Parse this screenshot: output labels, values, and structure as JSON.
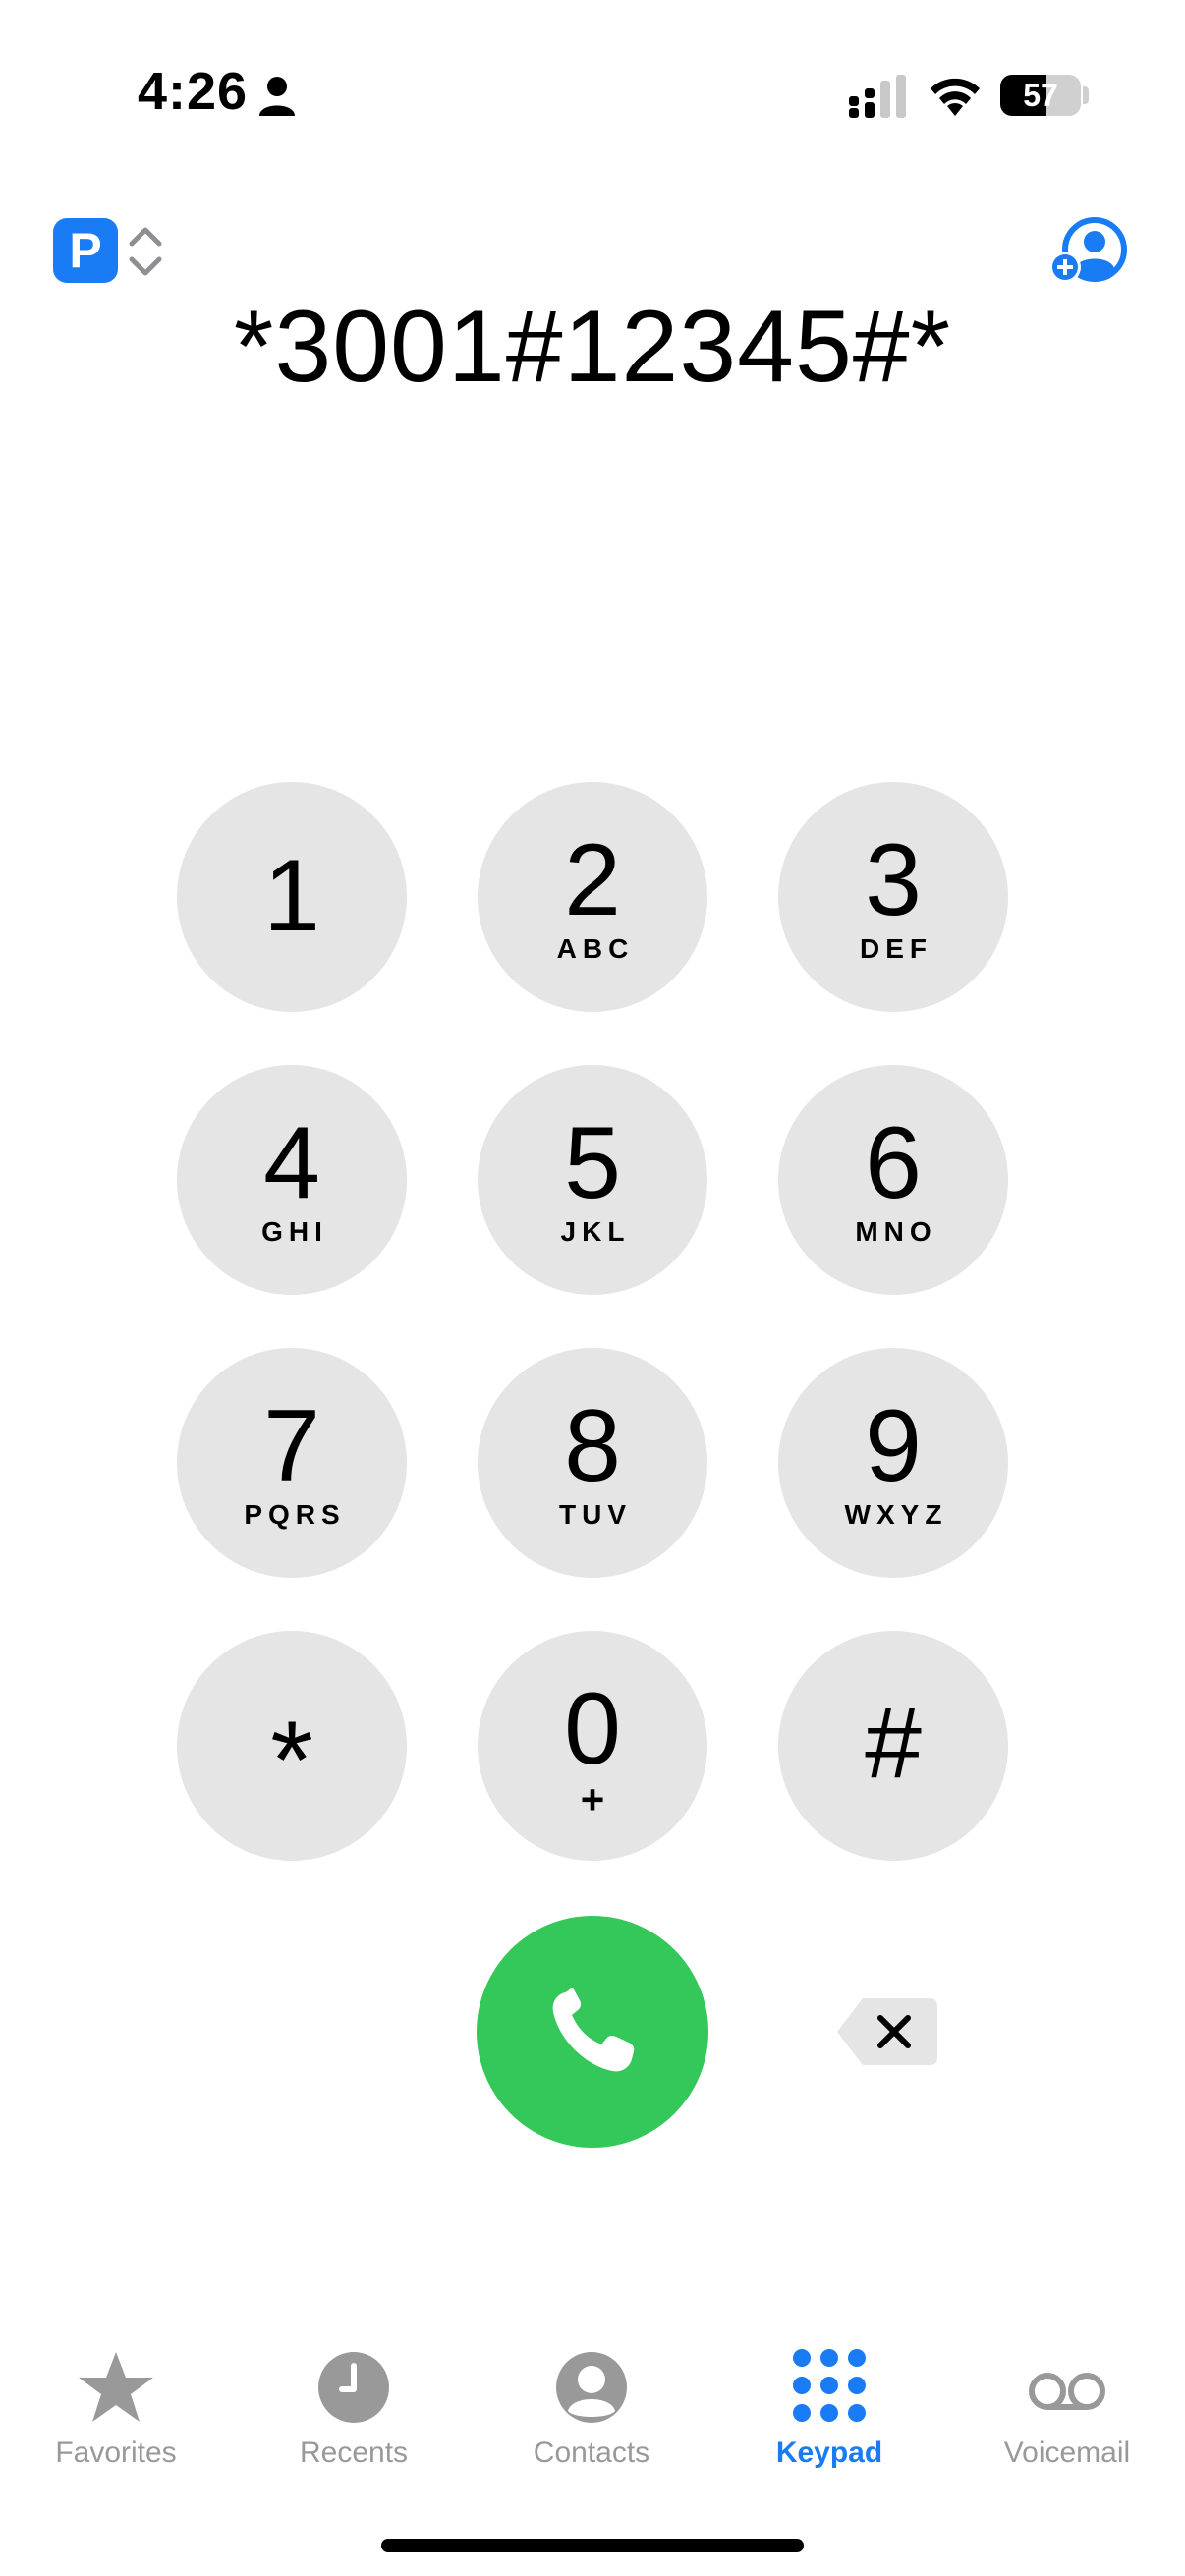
{
  "status_bar": {
    "time": "4:26",
    "battery_level": "57",
    "battery_fraction": 0.57
  },
  "line_selector": {
    "badge": "P"
  },
  "dialer": {
    "number": "*3001#12345#*"
  },
  "keypad": {
    "keys": [
      {
        "digit": "1",
        "letters": ""
      },
      {
        "digit": "2",
        "letters": "ABC"
      },
      {
        "digit": "3",
        "letters": "DEF"
      },
      {
        "digit": "4",
        "letters": "GHI"
      },
      {
        "digit": "5",
        "letters": "JKL"
      },
      {
        "digit": "6",
        "letters": "MNO"
      },
      {
        "digit": "7",
        "letters": "PQRS"
      },
      {
        "digit": "8",
        "letters": "TUV"
      },
      {
        "digit": "9",
        "letters": "WXYZ"
      },
      {
        "digit": "*",
        "letters": ""
      },
      {
        "digit": "0",
        "letters": "+"
      },
      {
        "digit": "#",
        "letters": ""
      }
    ]
  },
  "tabs": [
    {
      "label": "Favorites",
      "icon": "star-icon",
      "active": false
    },
    {
      "label": "Recents",
      "icon": "clock-icon",
      "active": false
    },
    {
      "label": "Contacts",
      "icon": "person-circle-icon",
      "active": false
    },
    {
      "label": "Keypad",
      "icon": "keypad-grid-icon",
      "active": true
    },
    {
      "label": "Voicemail",
      "icon": "voicemail-icon",
      "active": false
    }
  ],
  "colors": {
    "accent": "#1a7cf5",
    "call_green": "#34c759",
    "key_gray": "#e5e5e5",
    "inactive_tab": "#999999"
  }
}
